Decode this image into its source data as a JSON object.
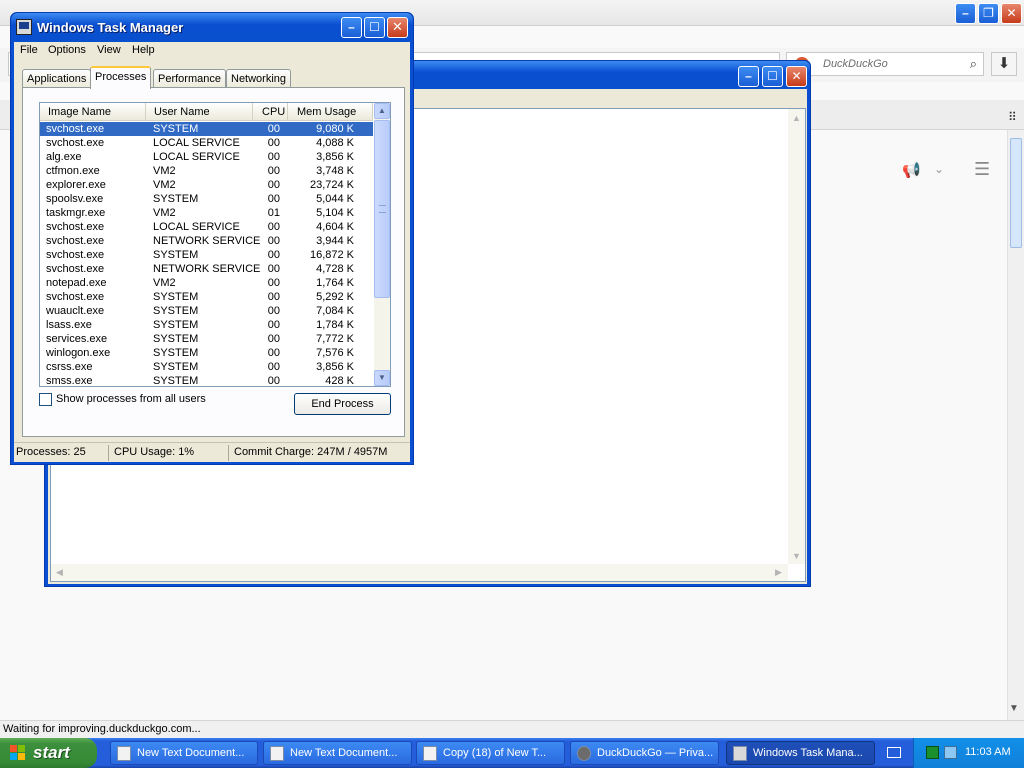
{
  "browser": {
    "search_placeholder": "DuckDuckGo",
    "status_text": "Waiting for improving.duckduckgo.com..."
  },
  "task_manager": {
    "title": "Windows Task Manager",
    "menu": [
      "File",
      "Options",
      "View",
      "Help"
    ],
    "tabs": [
      {
        "label": "Applications",
        "active": false
      },
      {
        "label": "Processes",
        "active": true
      },
      {
        "label": "Performance",
        "active": false
      },
      {
        "label": "Networking",
        "active": false
      }
    ],
    "columns": [
      "Image Name",
      "User Name",
      "CPU",
      "Mem Usage"
    ],
    "processes": [
      {
        "name": "svchost.exe",
        "user": "SYSTEM",
        "cpu": "00",
        "mem": "9,080 K",
        "selected": true
      },
      {
        "name": "svchost.exe",
        "user": "LOCAL SERVICE",
        "cpu": "00",
        "mem": "4,088 K"
      },
      {
        "name": "alg.exe",
        "user": "LOCAL SERVICE",
        "cpu": "00",
        "mem": "3,856 K"
      },
      {
        "name": "ctfmon.exe",
        "user": "VM2",
        "cpu": "00",
        "mem": "3,748 K"
      },
      {
        "name": "explorer.exe",
        "user": "VM2",
        "cpu": "00",
        "mem": "23,724 K"
      },
      {
        "name": "spoolsv.exe",
        "user": "SYSTEM",
        "cpu": "00",
        "mem": "5,044 K"
      },
      {
        "name": "taskmgr.exe",
        "user": "VM2",
        "cpu": "01",
        "mem": "5,104 K"
      },
      {
        "name": "svchost.exe",
        "user": "LOCAL SERVICE",
        "cpu": "00",
        "mem": "4,604 K"
      },
      {
        "name": "svchost.exe",
        "user": "NETWORK SERVICE",
        "cpu": "00",
        "mem": "3,944 K"
      },
      {
        "name": "svchost.exe",
        "user": "SYSTEM",
        "cpu": "00",
        "mem": "16,872 K"
      },
      {
        "name": "svchost.exe",
        "user": "NETWORK SERVICE",
        "cpu": "00",
        "mem": "4,728 K"
      },
      {
        "name": "notepad.exe",
        "user": "VM2",
        "cpu": "00",
        "mem": "1,764 K"
      },
      {
        "name": "svchost.exe",
        "user": "SYSTEM",
        "cpu": "00",
        "mem": "5,292 K"
      },
      {
        "name": "wuauclt.exe",
        "user": "SYSTEM",
        "cpu": "00",
        "mem": "7,084 K"
      },
      {
        "name": "lsass.exe",
        "user": "SYSTEM",
        "cpu": "00",
        "mem": "1,784 K"
      },
      {
        "name": "services.exe",
        "user": "SYSTEM",
        "cpu": "00",
        "mem": "7,772 K"
      },
      {
        "name": "winlogon.exe",
        "user": "SYSTEM",
        "cpu": "00",
        "mem": "7,576 K"
      },
      {
        "name": "csrss.exe",
        "user": "SYSTEM",
        "cpu": "00",
        "mem": "3,856 K"
      },
      {
        "name": "smss.exe",
        "user": "SYSTEM",
        "cpu": "00",
        "mem": "428 K"
      }
    ],
    "show_all_label": "Show processes from all users",
    "end_process_label": "End Process",
    "status": {
      "processes": "Processes: 25",
      "cpu": "CPU Usage: 1%",
      "commit": "Commit Charge: 247M / 4957M"
    }
  },
  "taskbar": {
    "start_label": "start",
    "items": [
      {
        "label": "New Text Document...",
        "active": false
      },
      {
        "label": "New Text Document...",
        "active": false
      },
      {
        "label": "Copy (18) of New T...",
        "active": false
      },
      {
        "label": "DuckDuckGo — Priva...",
        "active": false
      },
      {
        "label": "Windows Task Mana...",
        "active": true
      }
    ],
    "clock": "11:03 AM"
  }
}
